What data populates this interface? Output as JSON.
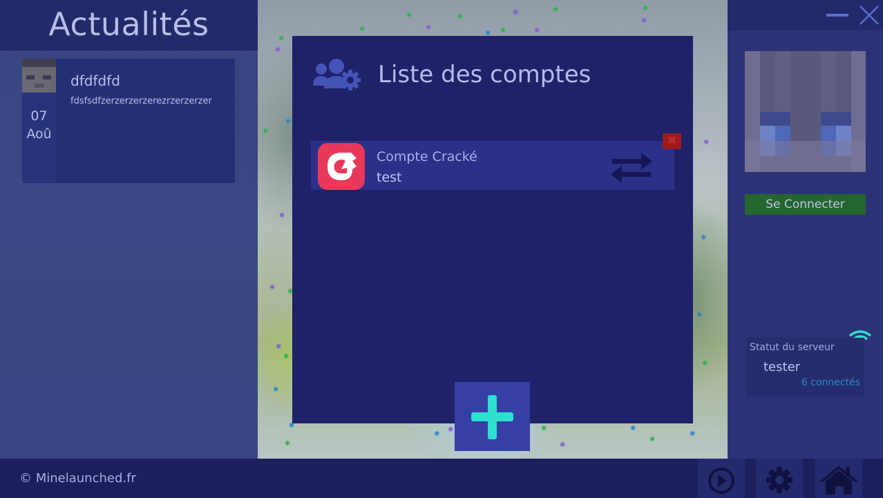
{
  "news": {
    "header_title": "Actualités",
    "items": [
      {
        "title": "dfdfdfd",
        "body": "fdsfsdfzerzerzerzerezrzerzerzer",
        "day": "07",
        "month": "Aoû"
      }
    ]
  },
  "accounts": {
    "title": "Liste des comptes",
    "list": [
      {
        "type": "Compte Cracké",
        "username": "test"
      }
    ],
    "delete_label": "✖",
    "add_icon": "plus-icon",
    "switch_icon": "switch-arrows-icon"
  },
  "profile": {
    "connect_label": "Se Connecter"
  },
  "server": {
    "label": "Statut du serveur",
    "name": "tester",
    "players": "6 connectés"
  },
  "footer": {
    "copyright": "© Minelaunched.fr",
    "nav_icons": [
      "play-icon",
      "gear-icon",
      "home-icon"
    ]
  },
  "colors": {
    "panel": "#1f2169",
    "accent_red": "#e8395a",
    "connect_green": "#25652e",
    "add_blue": "#353fa6",
    "teal": "#2ee0d0"
  }
}
